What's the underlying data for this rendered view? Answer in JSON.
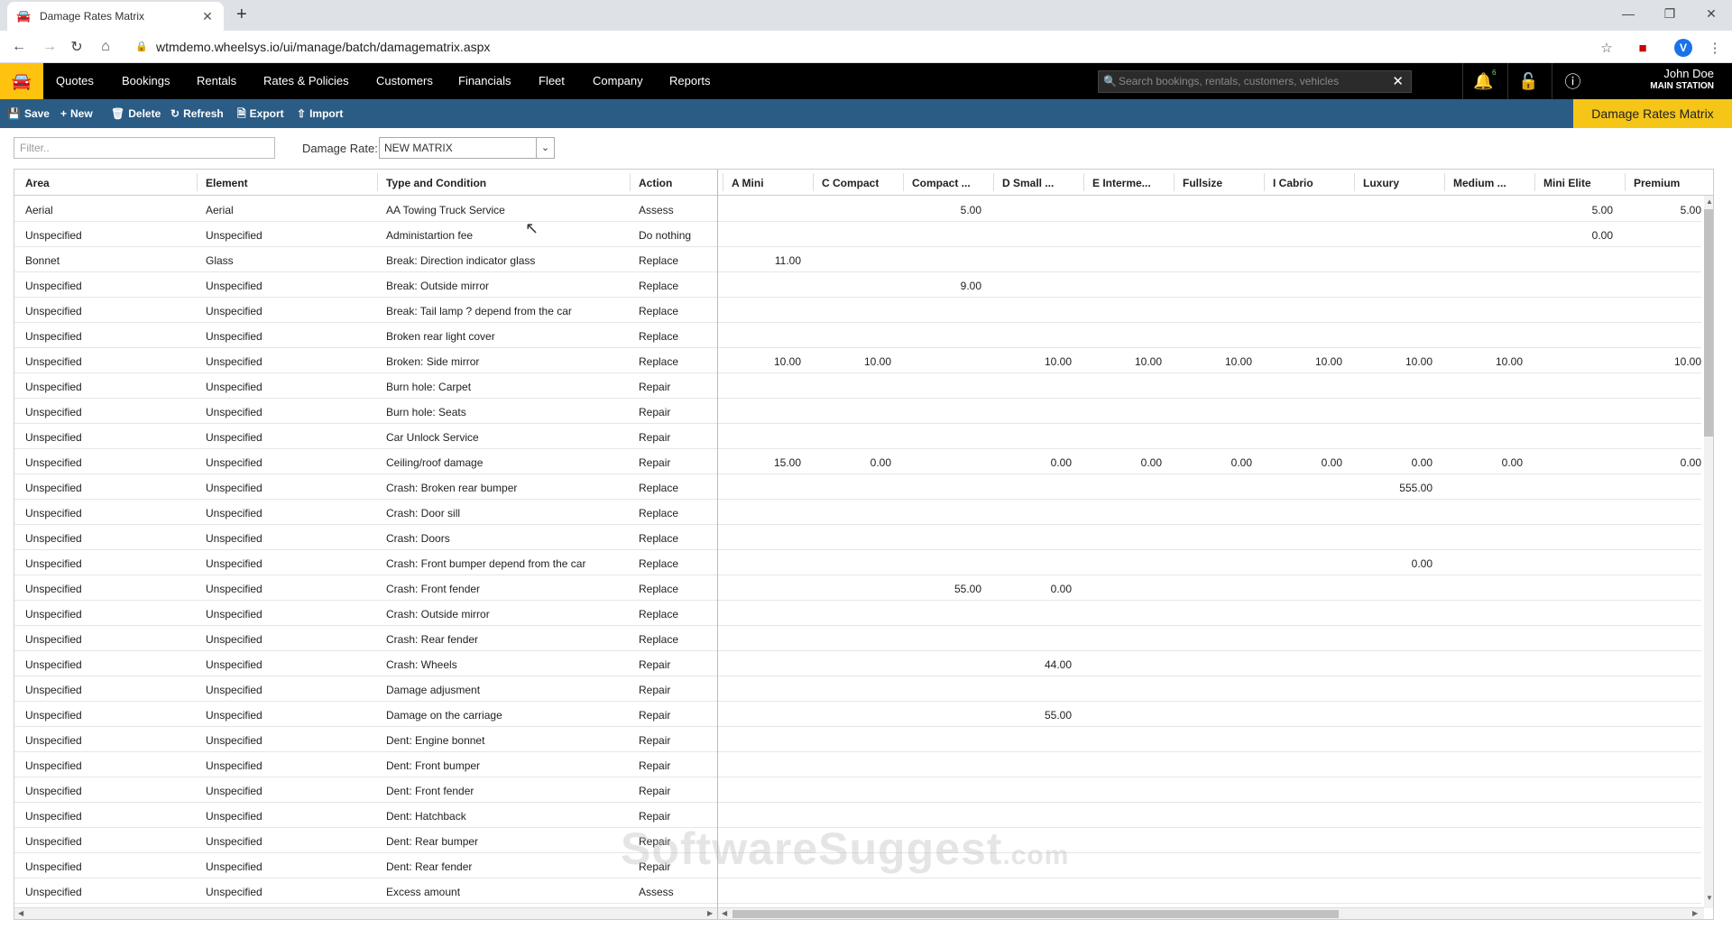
{
  "browser": {
    "tab_title": "Damage Rates Matrix",
    "url": "wtmdemo.wheelsys.io/ui/manage/batch/damagematrix.aspx",
    "avatar_letter": "V"
  },
  "nav": {
    "menu": [
      "Quotes",
      "Bookings",
      "Rentals",
      "Rates & Policies",
      "Customers",
      "Financials",
      "Fleet",
      "Company",
      "Reports"
    ],
    "search_placeholder": "Search bookings, rentals, customers, vehicles",
    "notification_count": "6",
    "user_name": "John Doe",
    "user_station": "MAIN STATION"
  },
  "toolbar": {
    "save": "Save",
    "new": "New",
    "delete": "Delete",
    "refresh": "Refresh",
    "export": "Export",
    "import": "Import",
    "page_title": "Damage Rates Matrix"
  },
  "filters": {
    "filter_placeholder": "Filter..",
    "damage_rate_label": "Damage Rate:",
    "damage_rate_value": "NEW MATRIX"
  },
  "grid": {
    "columns": [
      "Area",
      "Element",
      "Type and Condition",
      "Action",
      "A Mini",
      "C Compact",
      "Compact ...",
      "D Small ...",
      "E Interme...",
      "Fullsize",
      "I Cabrio",
      "Luxury",
      "Medium ...",
      "Mini Elite",
      "Premium"
    ],
    "rows": [
      [
        "Aerial",
        "Aerial",
        "AA Towing Truck Service",
        "Assess",
        "",
        "",
        "5.00",
        "",
        "",
        "",
        "",
        "",
        "",
        "5.00",
        "5.00"
      ],
      [
        "Unspecified",
        "Unspecified",
        "Administartion fee",
        "Do nothing",
        "",
        "",
        "",
        "",
        "",
        "",
        "",
        "",
        "",
        "0.00",
        ""
      ],
      [
        "Bonnet",
        "Glass",
        "Break: Direction indicator glass",
        "Replace",
        "11.00",
        "",
        "",
        "",
        "",
        "",
        "",
        "",
        "",
        "",
        ""
      ],
      [
        "Unspecified",
        "Unspecified",
        "Break: Outside mirror",
        "Replace",
        "",
        "",
        "9.00",
        "",
        "",
        "",
        "",
        "",
        "",
        "",
        ""
      ],
      [
        "Unspecified",
        "Unspecified",
        "Break: Tail lamp ? depend from the car",
        "Replace",
        "",
        "",
        "",
        "",
        "",
        "",
        "",
        "",
        "",
        "",
        ""
      ],
      [
        "Unspecified",
        "Unspecified",
        "Broken rear light cover",
        "Replace",
        "",
        "",
        "",
        "",
        "",
        "",
        "",
        "",
        "",
        "",
        ""
      ],
      [
        "Unspecified",
        "Unspecified",
        "Broken: Side mirror",
        "Replace",
        "10.00",
        "10.00",
        "",
        "10.00",
        "10.00",
        "10.00",
        "10.00",
        "10.00",
        "10.00",
        "",
        "10.00"
      ],
      [
        "Unspecified",
        "Unspecified",
        "Burn hole: Carpet",
        "Repair",
        "",
        "",
        "",
        "",
        "",
        "",
        "",
        "",
        "",
        "",
        ""
      ],
      [
        "Unspecified",
        "Unspecified",
        "Burn hole: Seats",
        "Repair",
        "",
        "",
        "",
        "",
        "",
        "",
        "",
        "",
        "",
        "",
        ""
      ],
      [
        "Unspecified",
        "Unspecified",
        "Car Unlock Service",
        "Repair",
        "",
        "",
        "",
        "",
        "",
        "",
        "",
        "",
        "",
        "",
        ""
      ],
      [
        "Unspecified",
        "Unspecified",
        "Ceiling/roof damage",
        "Repair",
        "15.00",
        "0.00",
        "",
        "0.00",
        "0.00",
        "0.00",
        "0.00",
        "0.00",
        "0.00",
        "",
        "0.00"
      ],
      [
        "Unspecified",
        "Unspecified",
        "Crash: Broken rear bumper",
        "Replace",
        "",
        "",
        "",
        "",
        "",
        "",
        "",
        "555.00",
        "",
        "",
        ""
      ],
      [
        "Unspecified",
        "Unspecified",
        "Crash: Door sill",
        "Replace",
        "",
        "",
        "",
        "",
        "",
        "",
        "",
        "",
        "",
        "",
        ""
      ],
      [
        "Unspecified",
        "Unspecified",
        "Crash: Doors",
        "Replace",
        "",
        "",
        "",
        "",
        "",
        "",
        "",
        "",
        "",
        "",
        ""
      ],
      [
        "Unspecified",
        "Unspecified",
        "Crash: Front bumper depend from the car",
        "Replace",
        "",
        "",
        "",
        "",
        "",
        "",
        "",
        "0.00",
        "",
        "",
        ""
      ],
      [
        "Unspecified",
        "Unspecified",
        "Crash: Front fender",
        "Replace",
        "",
        "",
        "55.00",
        "0.00",
        "",
        "",
        "",
        "",
        "",
        "",
        ""
      ],
      [
        "Unspecified",
        "Unspecified",
        "Crash: Outside mirror",
        "Replace",
        "",
        "",
        "",
        "",
        "",
        "",
        "",
        "",
        "",
        "",
        ""
      ],
      [
        "Unspecified",
        "Unspecified",
        "Crash: Rear fender",
        "Replace",
        "",
        "",
        "",
        "",
        "",
        "",
        "",
        "",
        "",
        "",
        ""
      ],
      [
        "Unspecified",
        "Unspecified",
        "Crash: Wheels",
        "Repair",
        "",
        "",
        "",
        "44.00",
        "",
        "",
        "",
        "",
        "",
        "",
        ""
      ],
      [
        "Unspecified",
        "Unspecified",
        "Damage adjusment",
        "Repair",
        "",
        "",
        "",
        "",
        "",
        "",
        "",
        "",
        "",
        "",
        ""
      ],
      [
        "Unspecified",
        "Unspecified",
        "Damage on the carriage",
        "Repair",
        "",
        "",
        "",
        "55.00",
        "",
        "",
        "",
        "",
        "",
        "",
        ""
      ],
      [
        "Unspecified",
        "Unspecified",
        "Dent: Engine bonnet",
        "Repair",
        "",
        "",
        "",
        "",
        "",
        "",
        "",
        "",
        "",
        "",
        ""
      ],
      [
        "Unspecified",
        "Unspecified",
        "Dent: Front bumper",
        "Repair",
        "",
        "",
        "",
        "",
        "",
        "",
        "",
        "",
        "",
        "",
        ""
      ],
      [
        "Unspecified",
        "Unspecified",
        "Dent: Front fender",
        "Repair",
        "",
        "",
        "",
        "",
        "",
        "",
        "",
        "",
        "",
        "",
        ""
      ],
      [
        "Unspecified",
        "Unspecified",
        "Dent: Hatchback",
        "Repair",
        "",
        "",
        "",
        "",
        "",
        "",
        "",
        "",
        "",
        "",
        ""
      ],
      [
        "Unspecified",
        "Unspecified",
        "Dent: Rear bumper",
        "Repair",
        "",
        "",
        "",
        "",
        "",
        "",
        "",
        "",
        "",
        "",
        ""
      ],
      [
        "Unspecified",
        "Unspecified",
        "Dent: Rear fender",
        "Repair",
        "",
        "",
        "",
        "",
        "",
        "",
        "",
        "",
        "",
        "",
        ""
      ],
      [
        "Unspecified",
        "Unspecified",
        "Excess amount",
        "Assess",
        "",
        "",
        "",
        "",
        "",
        "",
        "",
        "",
        "",
        "",
        ""
      ]
    ]
  },
  "watermark": {
    "main": "SoftwareSuggest",
    "suffix": ".com"
  }
}
